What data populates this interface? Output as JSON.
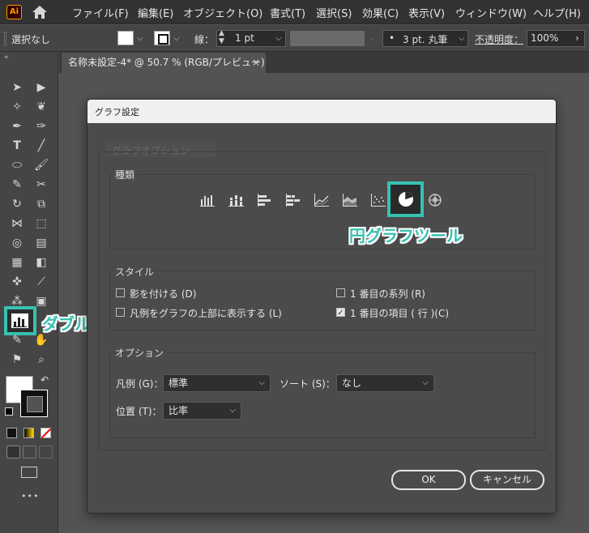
{
  "menubar": {
    "logo": "Ai",
    "items": [
      "ファイル(F)",
      "編集(E)",
      "オブジェクト(O)",
      "書式(T)",
      "選択(S)",
      "効果(C)",
      "表示(V)",
      "ウィンドウ(W)",
      "ヘルプ(H)"
    ]
  },
  "controlbar": {
    "selection_label": "選択なし",
    "stroke_label": "線：",
    "stroke_value": "1 pt",
    "brush_value": "3 pt. 丸筆",
    "opacity_label": "不透明度：",
    "opacity_value": "100%"
  },
  "document_tab": {
    "title": "名称未設定-4* @ 50.7 % (RGB/プレビュー)",
    "close": "×"
  },
  "dialog": {
    "title": "グラフ設定",
    "section_dropdown": "グラフオプション",
    "type_group": {
      "label": "種類",
      "types": [
        "column",
        "stacked-column",
        "bar",
        "stacked-bar",
        "line",
        "area",
        "scatter",
        "pie",
        "radar"
      ],
      "selected": "pie"
    },
    "style_group": {
      "label": "スタイル",
      "checkboxes": [
        {
          "label": "影を付ける (D)",
          "checked": false
        },
        {
          "label": "凡例をグラフの上部に表示する (L)",
          "checked": false
        },
        {
          "label": "1 番目の系列 (R)",
          "checked": false
        },
        {
          "label": "1 番目の項目 ( 行 )(C)",
          "checked": true
        }
      ]
    },
    "options_group": {
      "label": "オプション",
      "legend_label": "凡例 (G)：",
      "legend_value": "標準",
      "sort_label": "ソート (S)：",
      "sort_value": "なし",
      "position_label": "位置 (T)：",
      "position_value": "比率"
    },
    "ok_label": "OK",
    "cancel_label": "キャンセル"
  },
  "annotations": {
    "pie_tool": "円グラフツール",
    "double_click": "ダブルクリック",
    "accent_color": "#37c1b0"
  },
  "toolbar": {
    "more": "•••"
  }
}
